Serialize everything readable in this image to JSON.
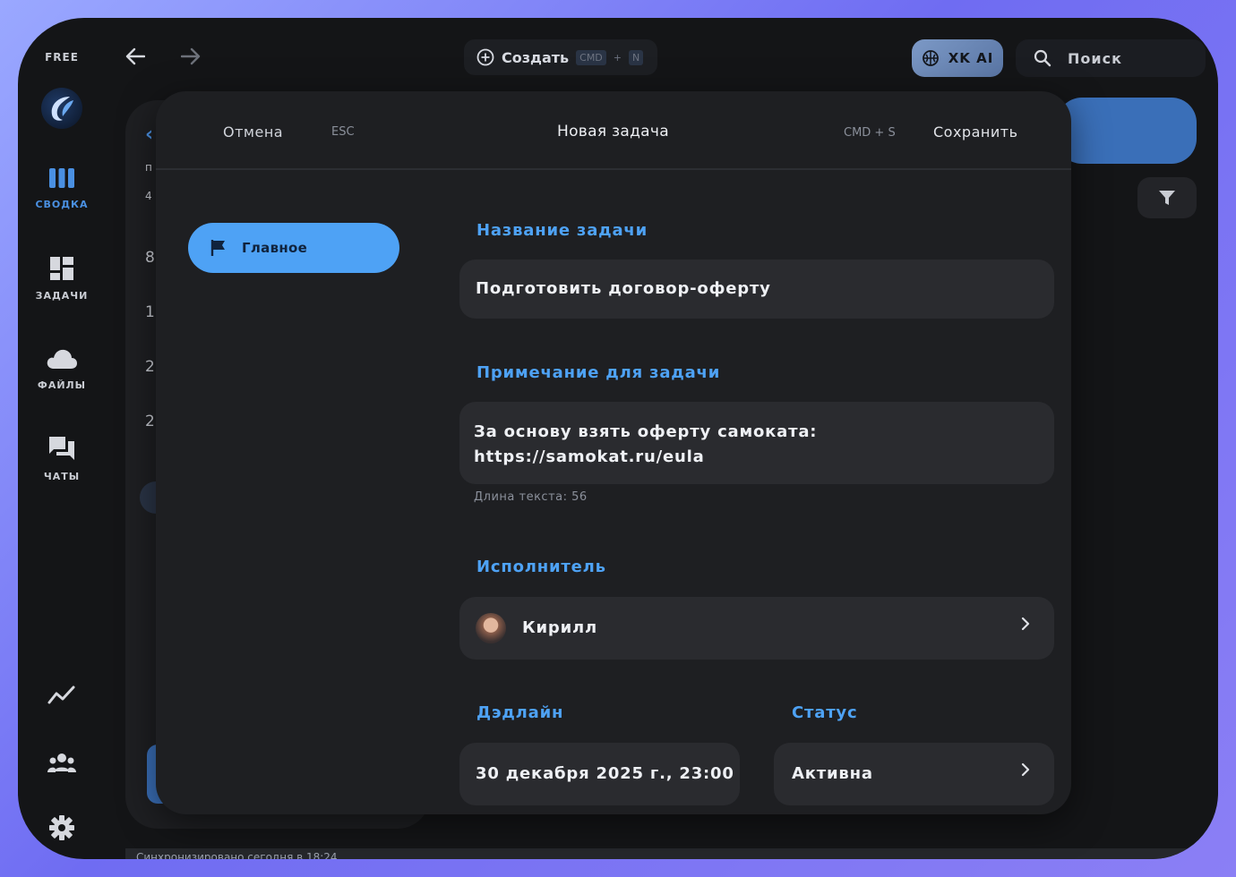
{
  "sidebar": {
    "plan_badge": "FREE",
    "items": [
      {
        "label": "СВОДКА",
        "icon": "columns-icon",
        "active": true
      },
      {
        "label": "ЗАДАЧИ",
        "icon": "dashboard-icon",
        "active": false
      },
      {
        "label": "ФАЙЛЫ",
        "icon": "cloud-icon",
        "active": false
      },
      {
        "label": "ЧАТЫ",
        "icon": "chat-icon",
        "active": false
      }
    ],
    "bottom_icons": [
      "analytics-icon",
      "team-icon",
      "gear-icon"
    ]
  },
  "topbar": {
    "create_label": "Создать",
    "create_shortcut_mod": "CMD",
    "create_shortcut_plus": "+",
    "create_shortcut_key": "N",
    "ai_label": "XK AI",
    "search_label": "Поиск"
  },
  "background": {
    "sync_text": "Синхронизировано сегодня в 18:24",
    "partial_nums": [
      "п",
      "4",
      "8",
      "1",
      "2",
      "2"
    ]
  },
  "modal": {
    "cancel_label": "Отмена",
    "cancel_shortcut": "ESC",
    "title": "Новая задача",
    "save_shortcut": "CMD + S",
    "save_label": "Сохранить",
    "tab_label": "Главное",
    "task_name_label": "Название задачи",
    "task_name_value": "Подготовить договор-оферту",
    "note_label": "Примечание для задачи",
    "note_line1": "За основу взять оферту самоката:",
    "note_line2": "https://samokat.ru/eula",
    "note_length": "Длина текста: 56",
    "assignee_label": "Исполнитель",
    "assignee_name": "Кирилл",
    "deadline_label": "Дэдлайн",
    "deadline_value": "30 декабря 2025 г., 23:00",
    "status_label": "Статус",
    "status_value": "Активна"
  },
  "colors": {
    "accent": "#4ea2f5",
    "surface": "#1e1f22",
    "field": "#2a2b2f",
    "page": "#141517"
  }
}
